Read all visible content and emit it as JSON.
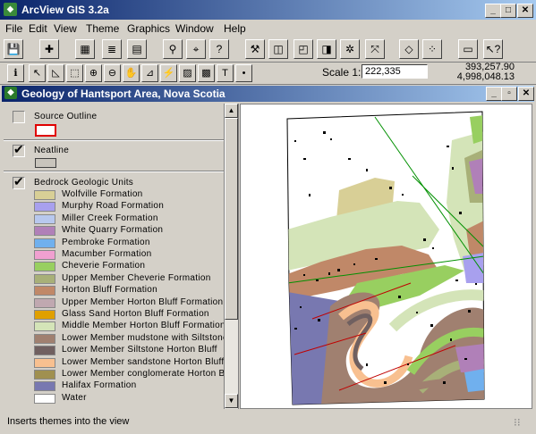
{
  "app": {
    "title": "ArcView GIS 3.2a",
    "window_buttons": {
      "minimize": "_",
      "maximize": "□",
      "close": "✕"
    }
  },
  "menu": [
    "File",
    "Edit",
    "View",
    "Theme",
    "Graphics",
    "Window",
    "Help"
  ],
  "toolbar1": [
    {
      "name": "save-project-icon",
      "glyph": "💾"
    },
    {
      "name": "add-theme-icon",
      "glyph": "✚"
    },
    {
      "name": "theme-properties-icon",
      "glyph": "▦"
    },
    {
      "name": "edit-legend-icon",
      "glyph": "≣"
    },
    {
      "name": "open-attribute-table-icon",
      "glyph": "▤"
    },
    {
      "name": "find-icon",
      "glyph": "⚲"
    },
    {
      "name": "locate-address-icon",
      "glyph": "⌖"
    },
    {
      "name": "query-builder-icon",
      "glyph": "?"
    },
    {
      "name": "hammer-icon",
      "glyph": "⚒"
    },
    {
      "name": "select-by-theme-icon",
      "glyph": "◫"
    },
    {
      "name": "zoom-to-full-extent-icon",
      "glyph": "◰"
    },
    {
      "name": "zoom-to-active-themes-icon",
      "glyph": "◨"
    },
    {
      "name": "zoom-in-fixed-icon",
      "glyph": "✲"
    },
    {
      "name": "zoom-out-fixed-icon",
      "glyph": "⤧"
    },
    {
      "name": "zoom-to-selected-icon",
      "glyph": "◇"
    },
    {
      "name": "clear-selection-icon",
      "glyph": "⁘"
    },
    {
      "name": "layout-icon",
      "glyph": "▭"
    },
    {
      "name": "help-icon",
      "glyph": "↖?"
    }
  ],
  "toolbar2": [
    {
      "name": "identify-tool-icon",
      "glyph": "ℹ"
    },
    {
      "name": "pointer-tool-icon",
      "glyph": "↖"
    },
    {
      "name": "vertex-edit-tool-icon",
      "glyph": "◺"
    },
    {
      "name": "select-feature-tool-icon",
      "glyph": "⬚"
    },
    {
      "name": "zoom-in-tool-icon",
      "glyph": "⊕"
    },
    {
      "name": "zoom-out-tool-icon",
      "glyph": "⊖"
    },
    {
      "name": "pan-tool-icon",
      "glyph": "✋"
    },
    {
      "name": "measure-tool-icon",
      "glyph": "⊿"
    },
    {
      "name": "hotlink-tool-icon",
      "glyph": "⚡"
    },
    {
      "name": "area-of-interest-tool-icon",
      "glyph": "▨"
    },
    {
      "name": "label-tool-icon",
      "glyph": "▩"
    },
    {
      "name": "text-tool-icon",
      "glyph": "T"
    },
    {
      "name": "draw-point-tool-icon",
      "glyph": "•"
    }
  ],
  "scale": {
    "label": "Scale 1:",
    "value": "222,335"
  },
  "coords": {
    "x": "393,257.90",
    "y": "4,998,048.13"
  },
  "view": {
    "title": "Geology of Hantsport Area, Nova Scotia",
    "window_buttons": {
      "minimize": "_",
      "maximize": "▫",
      "close": "✕"
    }
  },
  "toc": {
    "source_outline": "Source Outline",
    "neatline": "Neatline",
    "bedrock": "Bedrock Geologic Units",
    "legend": [
      {
        "label": "Wolfville Formation",
        "color": "#d8cf96"
      },
      {
        "label": "Murphy Road Formation",
        "color": "#a8a0ee"
      },
      {
        "label": "Miller Creek Formation",
        "color": "#b8c8ee"
      },
      {
        "label": "White Quarry Formation",
        "color": "#b080b8"
      },
      {
        "label": "Pembroke Formation",
        "color": "#70b0ee"
      },
      {
        "label": "Macumber Formation",
        "color": "#f0a0d0"
      },
      {
        "label": "Cheverie Formation",
        "color": "#98cf60"
      },
      {
        "label": "Upper Member Cheverie Formation",
        "color": "#a8b078"
      },
      {
        "label": "Horton Bluff Formation",
        "color": "#c08868"
      },
      {
        "label": "Upper Member Horton Bluff Formation",
        "color": "#c0a8b0"
      },
      {
        "label": "Glass Sand Horton Bluff Formation",
        "color": "#e0a000"
      },
      {
        "label": "Middle Member Horton Bluff Formation",
        "color": "#d4e4b8"
      },
      {
        "label": "Lower Member mudstone with Siltstone",
        "color": "#a08070"
      },
      {
        "label": "Lower Member Siltstone Horton Bluff",
        "color": "#706060"
      },
      {
        "label": "Lower Member sandstone Horton Bluff",
        "color": "#f8c090"
      },
      {
        "label": "Lower Member conglomerate Horton Bluff",
        "color": "#a09050"
      },
      {
        "label": "Halifax Formation",
        "color": "#7878b0"
      },
      {
        "label": "Water",
        "color": "#ffffff"
      }
    ]
  },
  "status": "Inserts themes into the view"
}
